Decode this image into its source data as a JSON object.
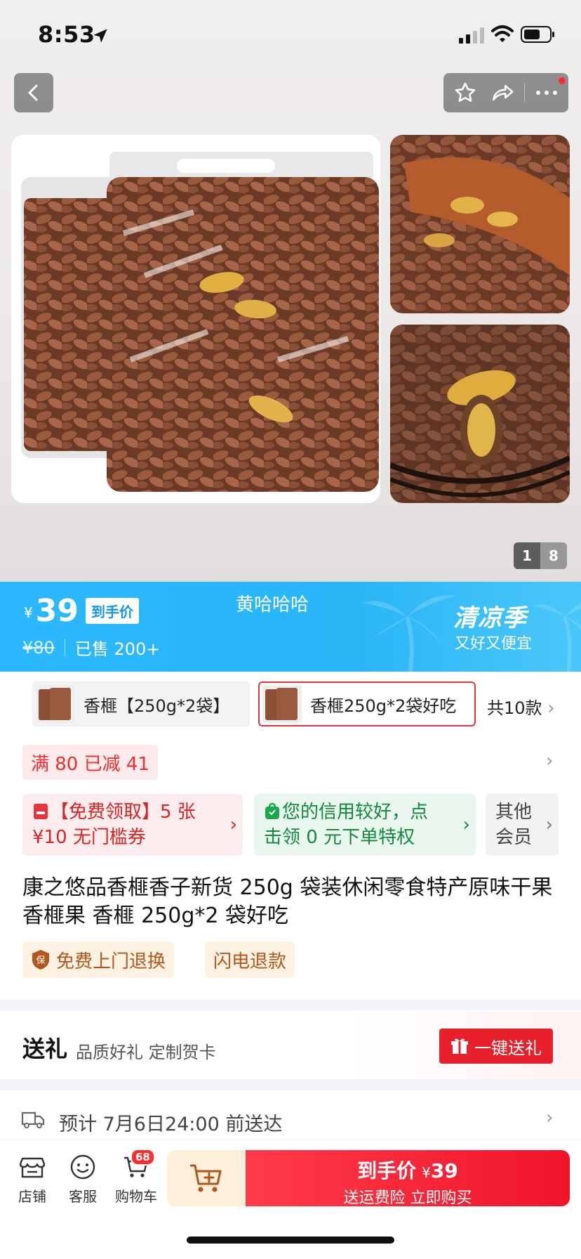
{
  "status_bar": {
    "time": "8:53"
  },
  "gallery": {
    "page_current": "1",
    "page_total": "8"
  },
  "price_banner": {
    "currency": "¥",
    "price": "39",
    "to_hand_label": "到手价",
    "original_price": "¥80",
    "sold": "已售 200+",
    "shop_nick": "黄哈哈哈",
    "season_title": "清凉季",
    "season_sub": "又好又便宜"
  },
  "sku": {
    "items": [
      {
        "label": "香榧【250g*2袋】",
        "selected": false
      },
      {
        "label": "香榧250g*2袋好吃",
        "selected": true
      }
    ],
    "count": "共10款"
  },
  "promo": {
    "label": "满 80 已减 41"
  },
  "coupons": [
    {
      "line1": "【免费领取】5 张",
      "line2": "¥10 无门槛券"
    },
    {
      "line1": "您的信用较好，点",
      "line2": "击领 0 元下单特权"
    },
    {
      "line1": "其他",
      "line2": "会员"
    }
  ],
  "product_title": "康之悠品香榧香子新货 250g 袋装休闲零食特产原味干果香榧果 香榧 250g*2 袋好吃",
  "tags": [
    {
      "label": "免费上门退换"
    },
    {
      "label": "闪电退款"
    }
  ],
  "gift": {
    "title": "送礼",
    "subtitle": "品质好礼 定制贺卡",
    "button": "一键送礼"
  },
  "delivery": {
    "text": "预计 7月6日24:00 前送达"
  },
  "bottom_bar": {
    "shop": "店铺",
    "service": "客服",
    "cart": "购物车",
    "cart_badge": "68",
    "buy_main": "到手价",
    "buy_currency": "¥",
    "buy_price": "39",
    "buy_sub": "送运费险 立即购买"
  },
  "colors": {
    "banner_blue": "#2cb8ff",
    "accent_red": "#e8202b",
    "coupon_green": "#14883d"
  }
}
